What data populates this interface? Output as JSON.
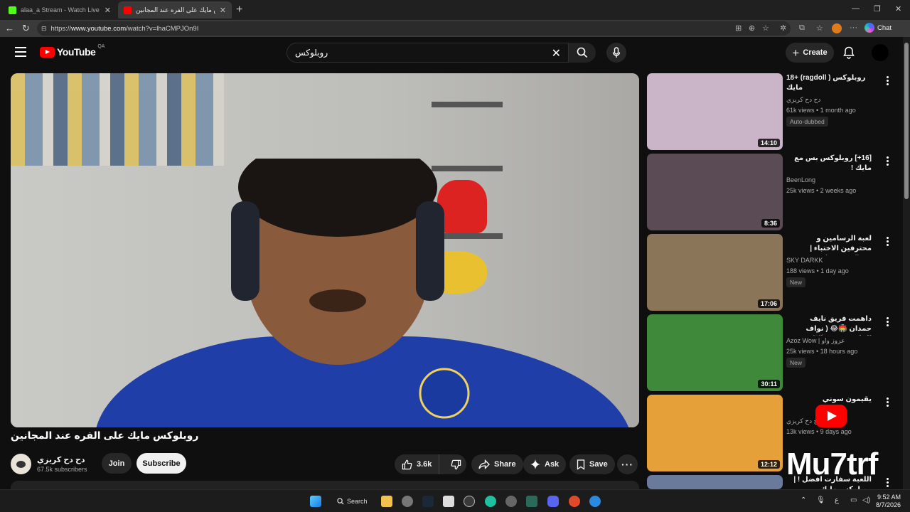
{
  "browser": {
    "tabs": [
      {
        "label": "alaa_a Stream - Watch Live on Kick",
        "active": false
      },
      {
        "label": "روبلوكس مايك على الفره عند المجانين",
        "active": true
      }
    ],
    "url_prefix": "https://",
    "url_host": "www.youtube.com",
    "url_path": "/watch?v=lhaCMPJOn9I",
    "chat_label": "Chat"
  },
  "header": {
    "logo_text": "YouTube",
    "logo_region": "QA",
    "search_value": "روبلوكس",
    "create_label": "Create"
  },
  "video": {
    "title": "روبلوكس مايك على الفره عند المجانين",
    "channel_name": "دح دح كريزي",
    "subscribers": "67.5k subscribers",
    "join_label": "Join",
    "subscribe_label": "Subscribe",
    "likes": "3.6k",
    "share_label": "Share",
    "ask_label": "Ask",
    "save_label": "Save"
  },
  "recommendations": [
    {
      "title": "18+ (ragdoll ) روبلوكس مايك",
      "channel": "دح دح كريزي",
      "meta": "61k views • 1 month ago",
      "badge": "Auto-dubbed",
      "duration": "14:10",
      "thumb_color": "#c9b4c8"
    },
    {
      "title": "[16+] روبلوكس بس مع مايك !",
      "channel": "BeenLong",
      "meta": "25k views • 2 weeks ago",
      "badge": "",
      "duration": "8:36",
      "thumb_color": "#5b4b55"
    },
    {
      "title": "لعبة الرسامين و محترفين الاختباء | Mecha Camelleon",
      "channel": "SKY DARKK",
      "meta": "188 views • 1 day ago",
      "badge": "New",
      "duration": "17:06",
      "thumb_color": "#8a7559"
    },
    {
      "title": "داهمت فريق نايف حمدان 🏟️😂 ( نواف الماجد مدرب!!🥳)",
      "channel": "Azoz Wow | عزوز واو",
      "meta": "25k views • 18 hours ago",
      "badge": "New",
      "duration": "30:11",
      "thumb_color": "#3e8a3a"
    },
    {
      "title": "يقيمون سوني",
      "channel": "دح دح كريزي",
      "meta": "13k views • 9 days ago",
      "badge": "",
      "duration": "12:12",
      "thumb_color": "#e5a03a"
    },
    {
      "title": "اللعبة سفارت افضل ! | روبلوكس مايك",
      "channel": "",
      "meta": "",
      "badge": "",
      "duration": "",
      "thumb_color": "#6a7a9a"
    }
  ],
  "watermark": "Mu7trf",
  "taskbar": {
    "search_label": "Search",
    "time": "9:52 AM",
    "date": "8/7/2026",
    "lang": "ع"
  }
}
